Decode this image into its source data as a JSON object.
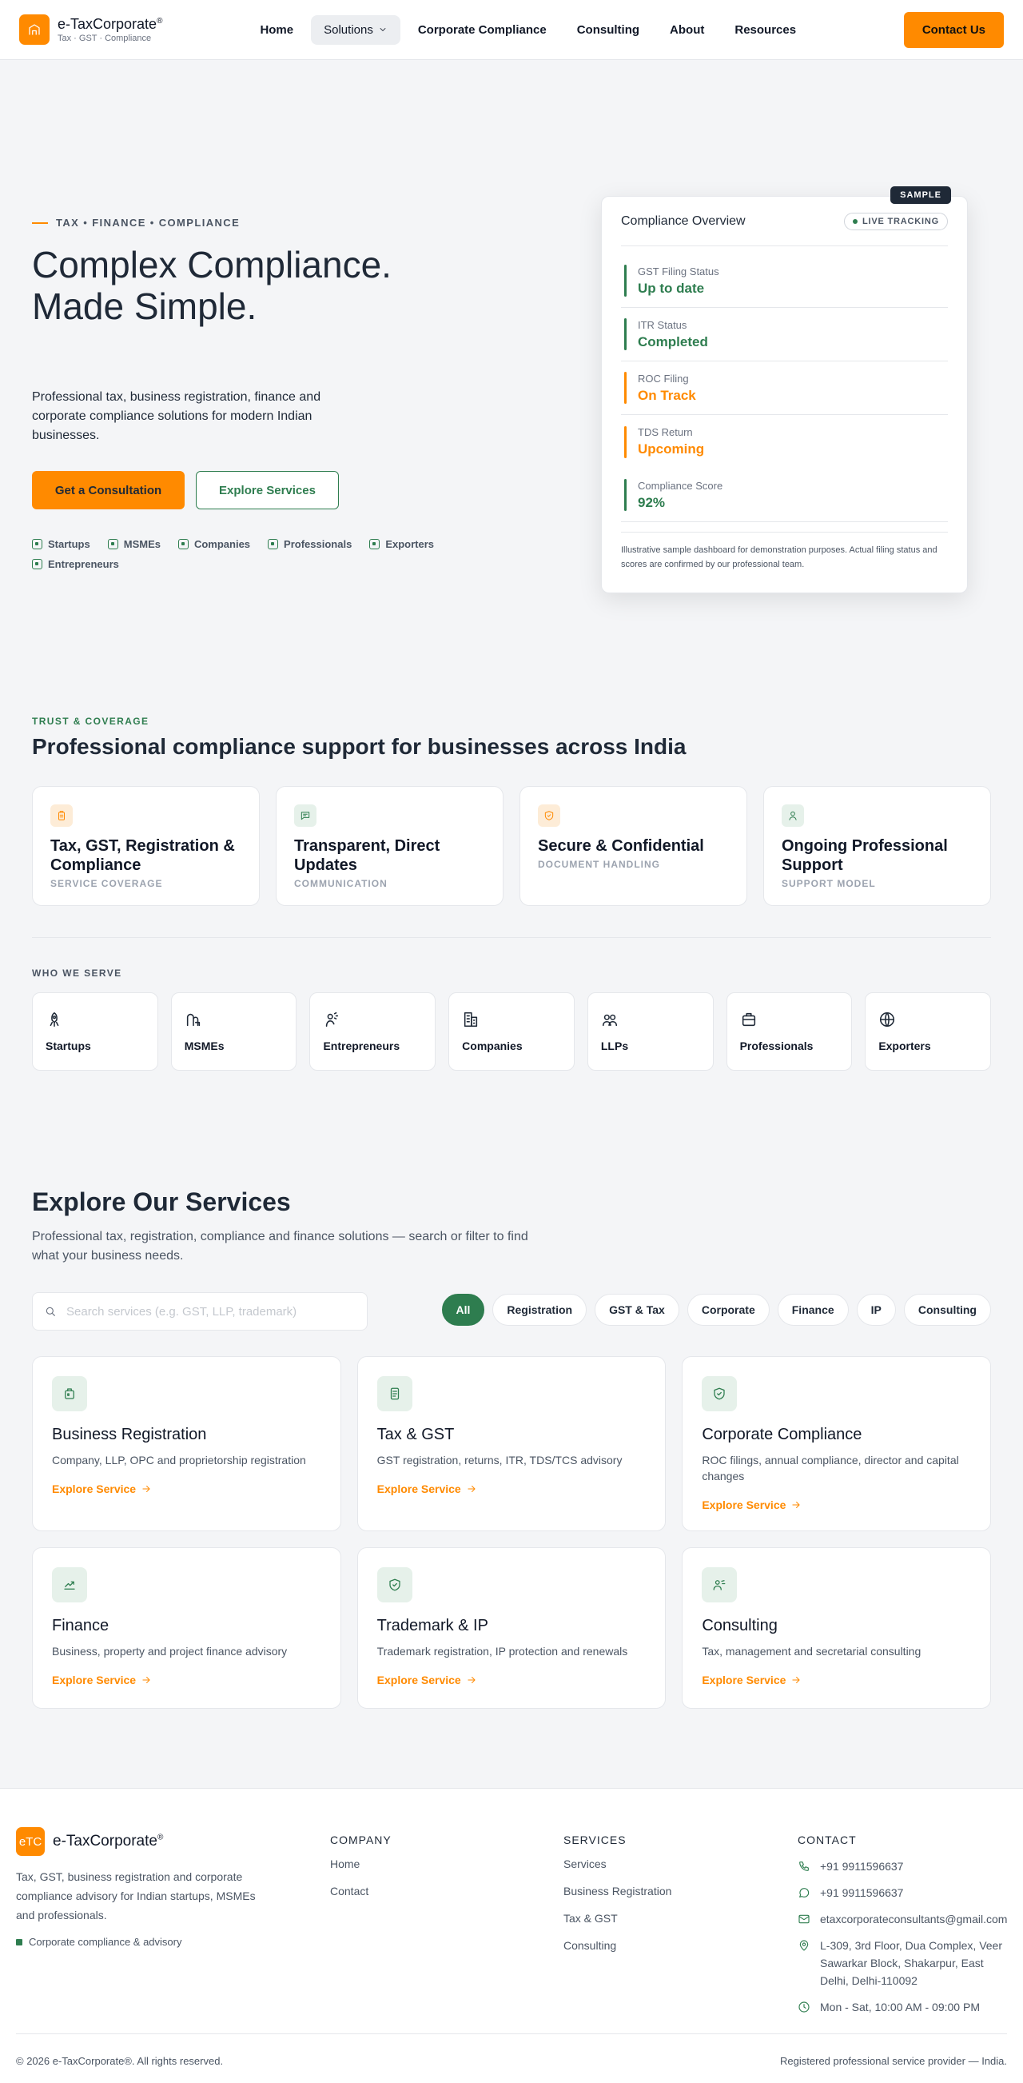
{
  "header": {
    "brand": "e-TaxCorporate",
    "brand_mark": "®",
    "tagline": "Tax · GST · Compliance",
    "nav": [
      {
        "label": "Home"
      },
      {
        "label": "Solutions"
      },
      {
        "label": "Corporate Compliance"
      },
      {
        "label": "Consulting"
      },
      {
        "label": "About"
      },
      {
        "label": "Resources"
      }
    ],
    "contact_label": "Contact Us"
  },
  "hero": {
    "eyebrow": "TAX • FINANCE • COMPLIANCE",
    "title": "Complex Compliance. Made Simple.",
    "description": "Professional tax, business registration, finance and corporate compliance solutions for modern Indian businesses.",
    "primary_cta": "Get a Consultation",
    "secondary_cta": "Explore Services",
    "audience": [
      "Startups",
      "MSMEs",
      "Companies",
      "Professionals",
      "Exporters",
      "Entrepreneurs"
    ]
  },
  "dashboard": {
    "sample_tag": "SAMPLE",
    "title": "Compliance Overview",
    "live_label": "LIVE TRACKING",
    "rows": [
      {
        "label": "GST Filing Status",
        "value": "Up to date",
        "color": "#2e7d4f"
      },
      {
        "label": "ITR Status",
        "value": "Completed",
        "color": "#2e7d4f"
      },
      {
        "label": "ROC Filing",
        "value": "On Track",
        "color": "#ff8a00"
      },
      {
        "label": "TDS Return",
        "value": "Upcoming",
        "color": "#ff8a00"
      },
      {
        "label": "Compliance Score",
        "value": "92%",
        "color": "#2e7d4f"
      }
    ],
    "note": "Illustrative sample dashboard for demonstration purposes. Actual filing status and scores are confirmed by our professional team."
  },
  "trust": {
    "label": "TRUST & COVERAGE",
    "title": "Professional compliance support for businesses across India",
    "cards": [
      {
        "title": "Tax, GST, Registration & Compliance",
        "subtitle": "SERVICE COVERAGE",
        "icon": "clipboard-icon"
      },
      {
        "title": "Transparent, Direct Updates",
        "subtitle": "COMMUNICATION",
        "icon": "chat-icon"
      },
      {
        "title": "Secure & Confidential",
        "subtitle": "DOCUMENT HANDLING",
        "icon": "shield-icon"
      },
      {
        "title": "Ongoing Professional Support",
        "subtitle": "SUPPORT MODEL",
        "icon": "user-icon"
      }
    ]
  },
  "who": {
    "label": "WHO WE SERVE",
    "items": [
      "Startups",
      "MSMEs",
      "Entrepreneurs",
      "Companies",
      "LLPs",
      "Professionals",
      "Exporters"
    ]
  },
  "services": {
    "title": "Explore Our Services",
    "description": "Professional tax, registration, compliance and finance solutions — search or filter to find what your business needs.",
    "search_placeholder": "Search services (e.g. GST, LLP, trademark)",
    "filters": [
      "All",
      "Registration",
      "GST & Tax",
      "Corporate",
      "Finance",
      "IP",
      "Consulting"
    ],
    "link_label": "Explore Service",
    "cards": [
      {
        "title": "Business Registration",
        "description": "Company, LLP, OPC and proprietorship registration"
      },
      {
        "title": "Tax & GST",
        "description": "GST registration, returns, ITR, TDS/TCS advisory"
      },
      {
        "title": "Corporate Compliance",
        "description": "ROC filings, annual compliance, director and capital changes"
      },
      {
        "title": "Finance",
        "description": "Business, property and project finance advisory"
      },
      {
        "title": "Trademark & IP",
        "description": "Trademark registration, IP protection and renewals"
      },
      {
        "title": "Consulting",
        "description": "Tax, management and secretarial consulting"
      }
    ]
  },
  "footer": {
    "logo_text": "eTC",
    "brand": "e-TaxCorporate",
    "brand_mark": "®",
    "description": "Tax, GST, business registration and corporate compliance advisory for Indian startups, MSMEs and professionals.",
    "tag": "Corporate compliance & advisory",
    "company_head": "COMPANY",
    "company_links": [
      "Home",
      "Contact"
    ],
    "services_head": "SERVICES",
    "services_links": [
      "Services",
      "Business Registration",
      "Tax & GST",
      "Consulting"
    ],
    "contact_head": "CONTACT",
    "phone": "+91 9911596637",
    "whatsapp": "+91 9911596637",
    "email": "etaxcorporateconsultants@gmail.com",
    "address": "L-309, 3rd Floor, Dua Complex, Veer Sawarkar Block, Shakarpur, East Delhi, Delhi-110092",
    "hours": "Mon - Sat, 10:00 AM - 09:00 PM",
    "copyright": "© 2026 e-TaxCorporate®. All rights reserved.",
    "registered": "Registered professional service provider — India."
  },
  "colors": {
    "accent": "#ff8a00",
    "brand_green": "#2e7d4f",
    "dark": "#1f2937"
  }
}
